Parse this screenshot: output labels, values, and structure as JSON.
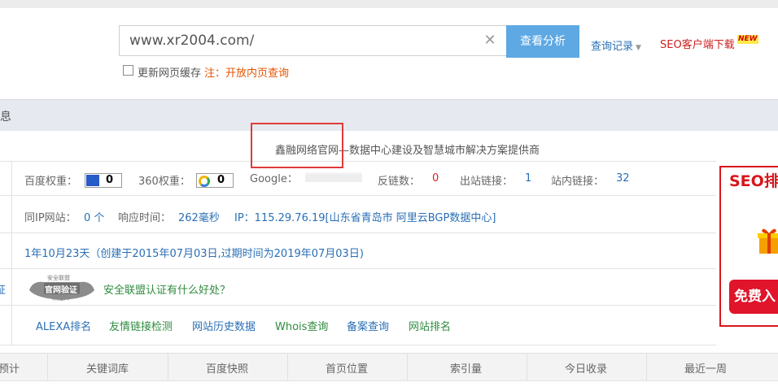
{
  "search": {
    "value": "www.xr2004.com/",
    "button": "查看分析",
    "history": "查询记录",
    "seo_download": "SEO客户端下载",
    "new_badge": "NEW",
    "cache_label": "更新网页缓存",
    "note": "注：开放内页查询"
  },
  "section": {
    "title": "信息"
  },
  "site": {
    "title": "鑫融网络官网—数据中心建设及智慧城市解决方案提供商"
  },
  "weights": {
    "baidu_label": "百度权重：",
    "baidu_value": "0",
    "w360_label": "360权重：",
    "w360_value": "0",
    "google_label": "Google：",
    "backlinks_label": "反链数：",
    "backlinks_value": "0",
    "outlinks_label": "出站链接：",
    "outlinks_value": "1",
    "inlinks_label": "站内链接：",
    "inlinks_value": "32"
  },
  "server": {
    "same_ip_label": "同IP网站：",
    "same_ip_value": "0 个",
    "response_label": "响应时间：",
    "response_value": "262毫秒",
    "ip": "IP：115.29.76.19[山东省青岛市 阿里云BGP数据中心]"
  },
  "domain_age": "1年10月23天（创建于2015年07月03日,过期时间为2019年07月03日)",
  "cert": {
    "left_label": "证",
    "badge_top": "安全联盟",
    "badge_main": "官网验证",
    "badge_sub": "未加入",
    "link": "安全联盟认证有什么好处？"
  },
  "tools": [
    "ALEXA排名",
    "友情链接检测",
    "网站历史数据",
    "Whois查询",
    "备案查询",
    "网站排名"
  ],
  "side_ad": {
    "title": "SEO排",
    "button": "免费入"
  },
  "table": {
    "headers": [
      "预计",
      "关键词库",
      "百度快照",
      "首页位置",
      "索引量",
      "今日收录",
      "最近一周"
    ]
  },
  "colors": {
    "accent": "#5ea8e3",
    "link": "#2a6fb5",
    "red": "#e02020",
    "green": "#2e8b3e"
  }
}
